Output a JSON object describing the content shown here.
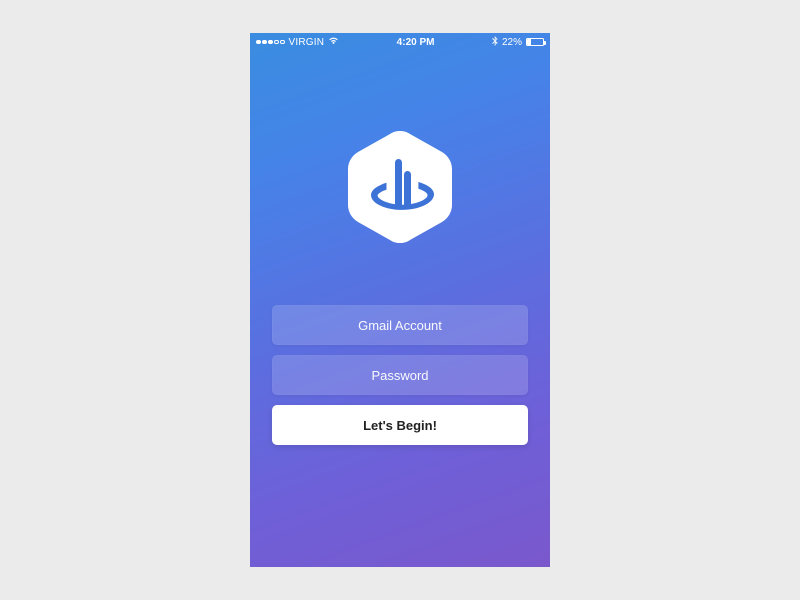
{
  "status": {
    "carrier": "VIRGIN",
    "time": "4:20 PM",
    "battery_text": "22%",
    "battery_level": 22
  },
  "form": {
    "email_placeholder": "Gmail Account",
    "password_placeholder": "Password",
    "submit_label": "Let's Begin!"
  },
  "colors": {
    "gradient_start": "#3a8de0",
    "gradient_end": "#7a58cc",
    "button_bg": "#ffffff"
  }
}
